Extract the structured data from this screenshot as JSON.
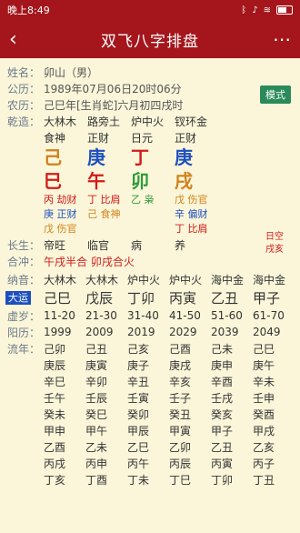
{
  "status": {
    "time": "晚上8:49"
  },
  "appbar": {
    "title": "双飞八字排盘"
  },
  "info": {
    "name_label": "姓名：",
    "name": "卯山（男）",
    "solar_label": "公历：",
    "solar": "1989年07月06日20时06分",
    "lunar_label": "农历：",
    "lunar": "己巳年[生肖蛇]六月初四戌时",
    "mode_label": "模式"
  },
  "pillars": {
    "row_label": "乾造：",
    "nayin": [
      "大林木",
      "路旁土",
      "炉中火",
      "钗环金"
    ],
    "shishen": [
      "食神",
      "正财",
      "日元",
      "正财"
    ],
    "gan": [
      {
        "t": "己",
        "c": "orange"
      },
      {
        "t": "庚",
        "c": "blue"
      },
      {
        "t": "丁",
        "c": "red"
      },
      {
        "t": "庚",
        "c": "blue"
      }
    ],
    "zhi": [
      {
        "t": "巳",
        "c": "red"
      },
      {
        "t": "午",
        "c": "red"
      },
      {
        "t": "卯",
        "c": "green"
      },
      {
        "t": "戌",
        "c": "orange"
      }
    ],
    "hidden": [
      [
        {
          "t": "丙 劫财",
          "c": "red"
        },
        {
          "t": "庚 正财",
          "c": "blue"
        },
        {
          "t": "戊 伤官",
          "c": "orange"
        }
      ],
      [
        {
          "t": "丁 比肩",
          "c": "red"
        },
        {
          "t": "己 食神",
          "c": "orange"
        }
      ],
      [
        {
          "t": "乙 枭",
          "c": "green"
        }
      ],
      [
        {
          "t": "戊 伤官",
          "c": "orange"
        },
        {
          "t": "辛 偏财",
          "c": "blue"
        },
        {
          "t": "丁 比肩",
          "c": "red"
        }
      ]
    ],
    "kong": [
      "日空",
      "戌亥"
    ]
  },
  "changsheng": {
    "label": "长生：",
    "values": [
      "帝旺",
      "临官",
      "病",
      "养"
    ]
  },
  "hehe": {
    "label": "合冲：",
    "value": "午戌半合 卯戌合火"
  },
  "nayin_row": {
    "label": "纳音：",
    "values": [
      "大林木",
      "大林木",
      "炉中火",
      "炉中火",
      "海中金",
      "海中金"
    ]
  },
  "dayun": {
    "label": "大运",
    "values": [
      {
        "t": "己巳",
        "c": "orange"
      },
      {
        "t": "戊辰",
        "c": "orange"
      },
      {
        "t": "丁卯",
        "c": "red"
      },
      {
        "t": "丙寅",
        "c": "red"
      },
      {
        "t": "乙丑",
        "c": "green"
      },
      {
        "t": "甲子",
        "c": "green"
      }
    ]
  },
  "xusui": {
    "label": "虚岁：",
    "values": [
      "11-20",
      "21-30",
      "31-40",
      "41-50",
      "51-60",
      "61-70"
    ]
  },
  "yangli": {
    "label": "阳历：",
    "values": [
      "1999",
      "2009",
      "2019",
      "2029",
      "2039",
      "2049"
    ]
  },
  "liunian": {
    "label": "流年：",
    "rows": [
      [
        "己卯",
        "己丑",
        "己亥",
        "己酉",
        "己未",
        "己巳"
      ],
      [
        "庚辰",
        "庚寅",
        "庚子",
        "庚戌",
        "庚申",
        "庚午"
      ],
      [
        "辛巳",
        "辛卯",
        "辛丑",
        "辛亥",
        "辛酉",
        "辛未"
      ],
      [
        "壬午",
        "壬辰",
        "壬寅",
        "壬子",
        "壬戌",
        "壬申"
      ],
      [
        "癸未",
        "癸巳",
        "癸卯",
        "癸丑",
        "癸亥",
        "癸酉"
      ],
      [
        "甲申",
        "甲午",
        "甲辰",
        "甲寅",
        "甲子",
        "甲戌"
      ],
      [
        "乙酉",
        "乙未",
        "乙巳",
        "乙卯",
        "乙丑",
        "乙亥"
      ],
      [
        "丙戌",
        "丙申",
        "丙午",
        "丙辰",
        "丙寅",
        "丙子"
      ],
      [
        "丁亥",
        "丁酉",
        "丁未",
        "丁巳",
        "丁卯",
        "丁丑"
      ]
    ]
  }
}
